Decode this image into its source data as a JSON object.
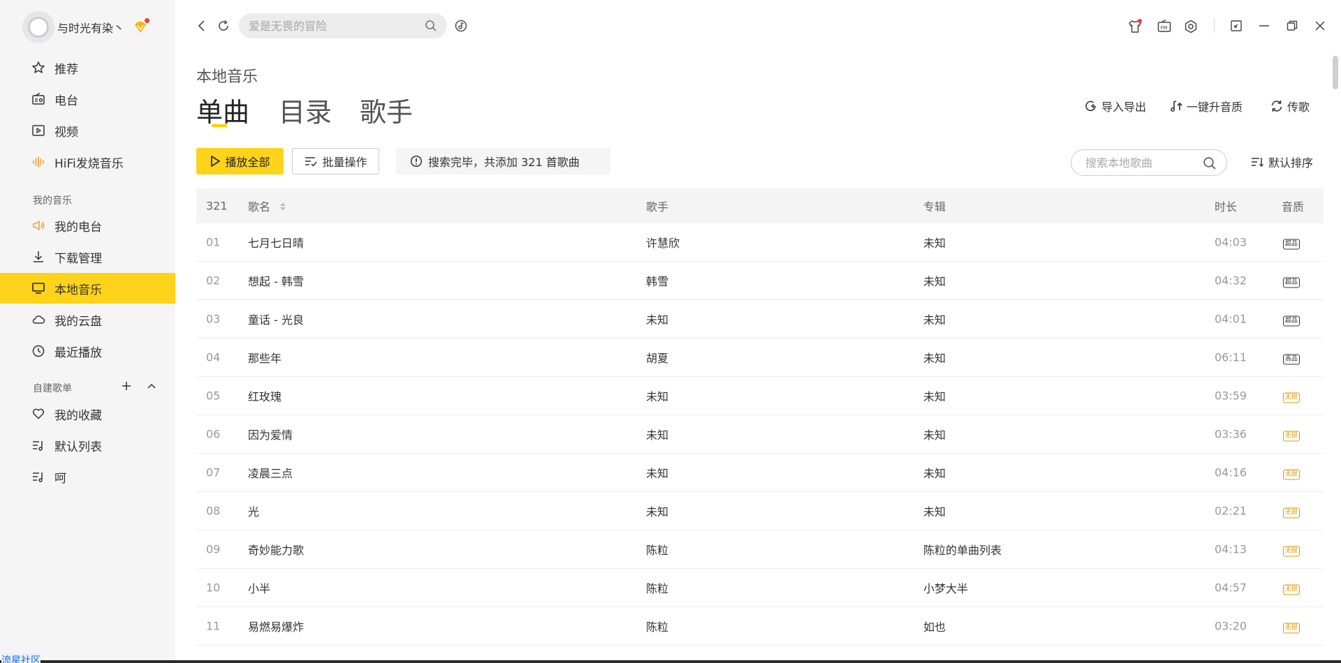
{
  "user": {
    "name": "与时光有染丶"
  },
  "sidebar": {
    "items_top": [
      {
        "label": "推荐",
        "icon": "star-icon"
      },
      {
        "label": "电台",
        "icon": "radio-icon"
      },
      {
        "label": "视频",
        "icon": "video-icon"
      },
      {
        "label": "HiFi发烧音乐",
        "icon": "soundwave-icon"
      }
    ],
    "section_my": "我的音乐",
    "items_my": [
      {
        "label": "我的电台",
        "icon": "speaker-icon"
      },
      {
        "label": "下载管理",
        "icon": "download-icon"
      },
      {
        "label": "本地音乐",
        "icon": "monitor-icon",
        "active": true
      },
      {
        "label": "我的云盘",
        "icon": "cloud-icon"
      },
      {
        "label": "最近播放",
        "icon": "clock-icon"
      }
    ],
    "section_playlists": "自建歌单",
    "items_playlists": [
      {
        "label": "我的收藏",
        "icon": "heart-icon"
      },
      {
        "label": "默认列表",
        "icon": "playlist-icon"
      },
      {
        "label": "呵",
        "icon": "playlist-icon"
      }
    ]
  },
  "search": {
    "placeholder": "爱是无畏的冒险"
  },
  "page": {
    "title": "本地音乐"
  },
  "tabs": [
    {
      "label": "单曲",
      "active": true
    },
    {
      "label": "目录"
    },
    {
      "label": "歌手"
    }
  ],
  "actions": {
    "import_export": "导入导出",
    "upgrade_quality": "一键升音质",
    "transfer": "传歌"
  },
  "toolbar": {
    "play_all": "播放全部",
    "batch": "批量操作",
    "notice": "搜索完毕，共添加 321 首歌曲",
    "local_search_placeholder": "搜索本地歌曲",
    "sort": "默认排序"
  },
  "table": {
    "headers": {
      "count": "321",
      "title": "歌名",
      "artist": "歌手",
      "album": "专辑",
      "duration": "时长",
      "quality": "音质"
    },
    "rows": [
      {
        "num": "01",
        "title": "七月七日晴",
        "artist": "许慧欣",
        "album": "未知",
        "duration": "04:03",
        "quality": "超品",
        "gold": false
      },
      {
        "num": "02",
        "title": "想起 - 韩雪",
        "artist": "韩雪",
        "album": "未知",
        "duration": "04:32",
        "quality": "超品",
        "gold": false
      },
      {
        "num": "03",
        "title": "童话 - 光良",
        "artist": "未知",
        "album": "未知",
        "duration": "04:01",
        "quality": "超品",
        "gold": false
      },
      {
        "num": "04",
        "title": "那些年",
        "artist": "胡夏",
        "album": "未知",
        "duration": "06:11",
        "quality": "高品",
        "gold": false
      },
      {
        "num": "05",
        "title": "红玫瑰",
        "artist": "未知",
        "album": "未知",
        "duration": "03:59",
        "quality": "无损",
        "gold": true
      },
      {
        "num": "06",
        "title": "因为爱情",
        "artist": "未知",
        "album": "未知",
        "duration": "03:36",
        "quality": "无损",
        "gold": true
      },
      {
        "num": "07",
        "title": "凌晨三点",
        "artist": "未知",
        "album": "未知",
        "duration": "04:16",
        "quality": "无损",
        "gold": true
      },
      {
        "num": "08",
        "title": "光",
        "artist": "未知",
        "album": "未知",
        "duration": "02:21",
        "quality": "无损",
        "gold": true
      },
      {
        "num": "09",
        "title": "奇妙能力歌",
        "artist": "陈粒",
        "album": "陈粒的单曲列表",
        "duration": "04:13",
        "quality": "无损",
        "gold": true
      },
      {
        "num": "10",
        "title": "小半",
        "artist": "陈粒",
        "album": "小梦大半",
        "duration": "04:57",
        "quality": "无损",
        "gold": true
      },
      {
        "num": "11",
        "title": "易燃易爆炸",
        "artist": "陈粒",
        "album": "如也",
        "duration": "03:20",
        "quality": "无损",
        "gold": true
      }
    ]
  },
  "watermark": "流星社区",
  "colors": {
    "accent": "#ffd31a",
    "gold_badge": "#d89b00",
    "sidebar_bg": "#f5f5f5"
  }
}
